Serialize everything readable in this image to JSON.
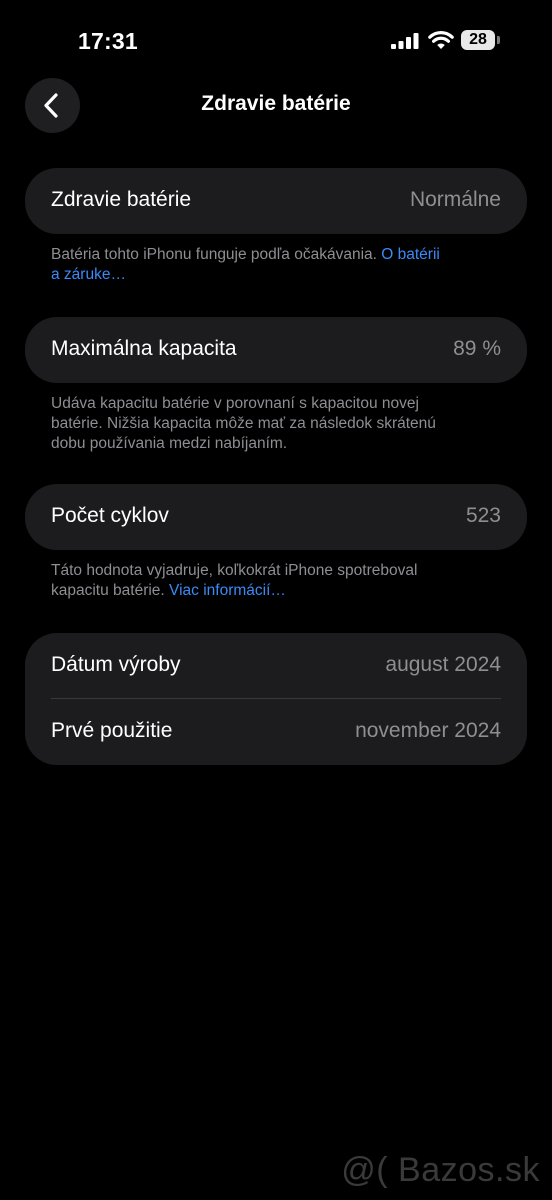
{
  "status_bar": {
    "time": "17:31",
    "battery_level": "28",
    "icons": [
      "signal-icon",
      "wifi-icon",
      "battery-icon"
    ]
  },
  "nav": {
    "back_icon": "chevron-left-icon",
    "title": "Zdravie batérie"
  },
  "health": {
    "label": "Zdravie batérie",
    "value": "Normálne",
    "footnote": "Batéria tohto iPhonu funguje podľa očakávania. ",
    "footnote_link_1": "O batérii",
    "footnote_link_2": "a záruke…"
  },
  "capacity": {
    "label": "Maximálna kapacita",
    "value": "89 %",
    "footnote_1": "Udáva kapacitu batérie v porovnaní s kapacitou novej",
    "footnote_2": "batérie. Nižšia kapacita môže mať za následok skrátenú",
    "footnote_3": "dobu používania medzi nabíjaním."
  },
  "cycles": {
    "label": "Počet cyklov",
    "value": "523",
    "footnote_1": "Táto hodnota vyjadruje, koľkokrát iPhone spotreboval",
    "footnote_2": "kapacitu batérie. ",
    "footnote_link": "Viac informácií…"
  },
  "dates": {
    "manufacture_label": "Dátum výroby",
    "manufacture_value": "august 2024",
    "first_use_label": "Prvé použitie",
    "first_use_value": "november 2024"
  },
  "watermark": "@( Bazos.sk",
  "colors": {
    "background": "#000000",
    "card": "#1c1c1e",
    "secondary_text": "#8e8e93",
    "link": "#3b8af7"
  }
}
